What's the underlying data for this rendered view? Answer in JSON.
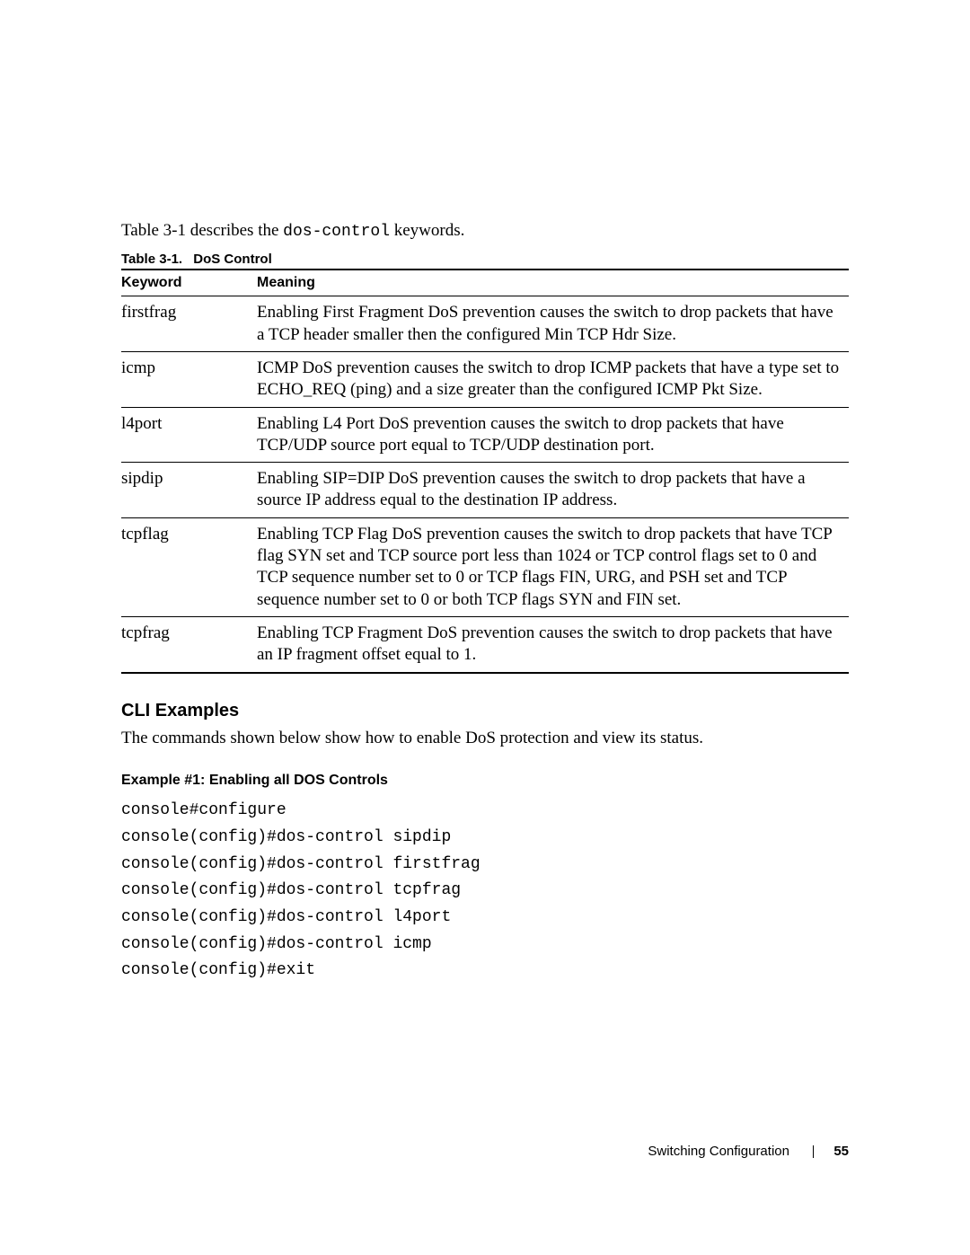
{
  "intro": {
    "prefix": "Table 3-1 describes the ",
    "keyword": "dos-control",
    "suffix": " keywords."
  },
  "table": {
    "caption_label": "Table 3-1.",
    "caption_title": "DoS Control",
    "header_keyword": "Keyword",
    "header_meaning": "Meaning",
    "rows": [
      {
        "keyword": "firstfrag",
        "meaning": "Enabling First Fragment DoS prevention causes the switch to drop packets that have a TCP header smaller then the configured Min TCP Hdr Size."
      },
      {
        "keyword": "icmp",
        "meaning": "ICMP DoS prevention causes the switch to drop ICMP packets that have a type set to ECHO_REQ (ping) and a size greater than the configured ICMP Pkt Size."
      },
      {
        "keyword": "l4port",
        "meaning": "Enabling L4 Port DoS prevention causes the switch to drop packets that have TCP/UDP source port equal to TCP/UDP destination port."
      },
      {
        "keyword": "sipdip",
        "meaning": "Enabling SIP=DIP DoS prevention causes the switch to drop packets that have a source IP address equal to the destination IP address."
      },
      {
        "keyword": "tcpflag",
        "meaning": "Enabling TCP Flag DoS prevention causes the switch to drop packets that have TCP flag SYN set and TCP source port less than 1024 or TCP control flags set to 0 and TCP sequence number set to 0 or TCP flags FIN, URG, and PSH set and TCP sequence number set to 0 or both TCP flags SYN and FIN set."
      },
      {
        "keyword": "tcpfrag",
        "meaning": "Enabling TCP Fragment DoS prevention causes the switch to drop packets that have an IP fragment offset equal to 1."
      }
    ]
  },
  "cli": {
    "heading": "CLI Examples",
    "description": "The commands shown below show how to enable DoS protection and view its status.",
    "example_title": "Example #1: Enabling all DOS Controls",
    "lines": [
      "console#configure",
      "console(config)#dos-control sipdip",
      "console(config)#dos-control firstfrag",
      "console(config)#dos-control tcpfrag",
      "console(config)#dos-control l4port",
      "console(config)#dos-control icmp",
      "console(config)#exit"
    ]
  },
  "footer": {
    "section": "Switching Configuration",
    "page": "55"
  }
}
